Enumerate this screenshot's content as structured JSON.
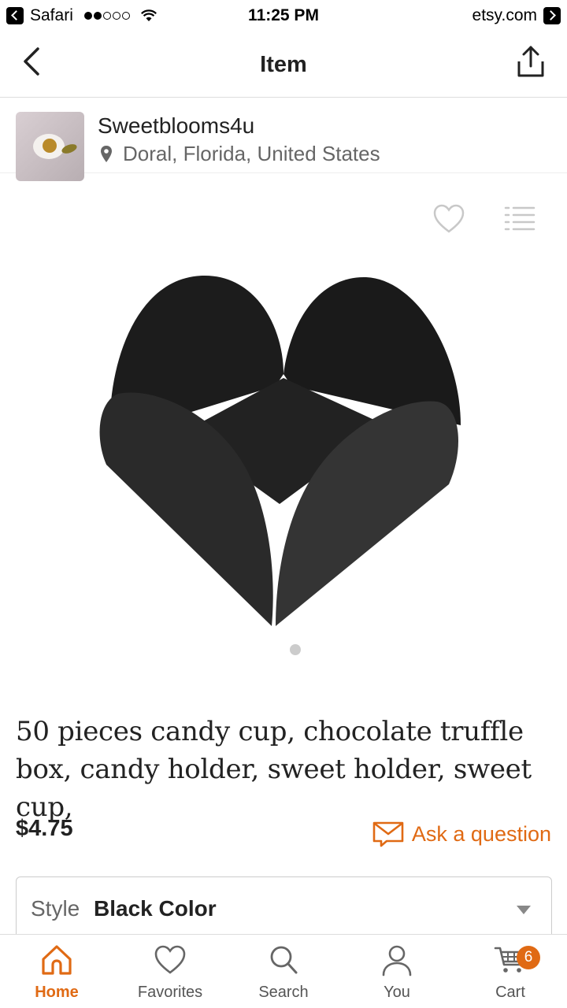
{
  "status_bar": {
    "back_app": "Safari",
    "signal_dots": [
      true,
      true,
      false,
      false,
      false
    ],
    "time": "11:25 PM",
    "site": "etsy.com"
  },
  "nav": {
    "title": "Item",
    "back_icon": "chevron-left-icon",
    "share_icon": "share-icon"
  },
  "shop": {
    "name": "Sweetblooms4u",
    "location": "Doral, Florida, United States"
  },
  "listing": {
    "title": "50 pieces candy cup, chocolate truffle box, candy holder, sweet holder, sweet cup,",
    "price": "$4.75",
    "ask_question": "Ask a question",
    "image_count": 1,
    "current_image": 1
  },
  "options": {
    "style_label": "Style",
    "style_value": "Black Color"
  },
  "tab_bar": {
    "tabs": [
      {
        "label": "Home",
        "icon": "home-icon",
        "active": true
      },
      {
        "label": "Favorites",
        "icon": "heart-icon",
        "active": false
      },
      {
        "label": "Search",
        "icon": "search-icon",
        "active": false
      },
      {
        "label": "You",
        "icon": "person-icon",
        "active": false
      },
      {
        "label": "Cart",
        "icon": "cart-icon",
        "active": false
      }
    ],
    "cart_count": "6"
  },
  "colors": {
    "accent": "#e06a14",
    "text": "#222222",
    "muted": "#666666"
  }
}
